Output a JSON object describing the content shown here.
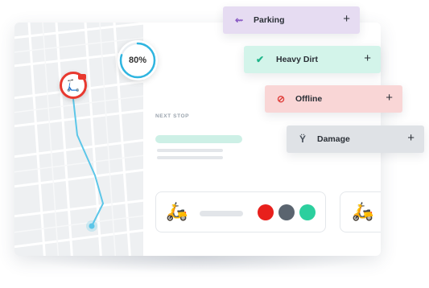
{
  "progress": {
    "label": "80%",
    "value": 0.8,
    "color": "#2fb5e0"
  },
  "next_stop": {
    "label": "NEXT STOP"
  },
  "vehicle": {
    "icon": "scooter-icon",
    "status_colors": [
      "#e8201c",
      "#5a646f",
      "#2ccf9e"
    ]
  },
  "tags": [
    {
      "label": "Parking",
      "icon": "parking-icon",
      "icon_glyph": "⇜",
      "icon_color": "#8a5bc4",
      "action": "+"
    },
    {
      "label": "Heavy Dirt",
      "icon": "broom-icon",
      "icon_glyph": "✔",
      "icon_color": "#1fb589",
      "action": "+"
    },
    {
      "label": "Offline",
      "icon": "offline-icon",
      "icon_glyph": "⊘",
      "icon_color": "#e0413d",
      "action": "+"
    },
    {
      "label": "Damage",
      "icon": "wrench-icon",
      "icon_glyph": "Ÿ",
      "icon_color": "#4a525c",
      "action": "+"
    }
  ],
  "colors": {
    "route": "#5cc6e8",
    "pin": "#e8392f"
  }
}
